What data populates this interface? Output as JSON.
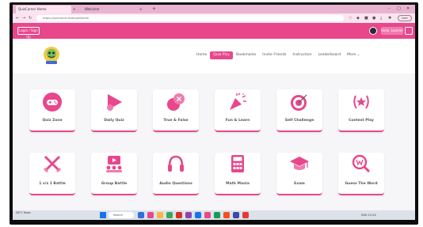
{
  "browser": {
    "tabs": [
      {
        "label": "QuizCorner Home",
        "active": true
      },
      {
        "label": "Welcome",
        "active": false
      }
    ],
    "url": "https://quizcorner.example/home",
    "profile_label": "User"
  },
  "sitebar": {
    "login_label": "Login / Sign Up",
    "user_label": "Hello, Learner"
  },
  "nav": {
    "items": [
      {
        "label": "Home",
        "active": false
      },
      {
        "label": "Quiz Play",
        "active": true
      },
      {
        "label": "Bookmarks",
        "active": false
      },
      {
        "label": "Invite Friends",
        "active": false
      },
      {
        "label": "Instruction",
        "active": false
      },
      {
        "label": "Leaderboard",
        "active": false
      },
      {
        "label": "More ⌄",
        "active": false
      }
    ]
  },
  "cards": [
    {
      "label": "Quiz Zone",
      "icon": "gamepad-icon"
    },
    {
      "label": "Daily Quiz",
      "icon": "play-icon"
    },
    {
      "label": "True & False",
      "icon": "true-false-icon"
    },
    {
      "label": "Fun & Learn",
      "icon": "party-popper-icon"
    },
    {
      "label": "Self Challenge",
      "icon": "target-icon"
    },
    {
      "label": "Contest Play",
      "icon": "star-laurel-icon"
    },
    {
      "label": "1 v/s 1 Battle",
      "icon": "crossed-swords-icon"
    },
    {
      "label": "Group Battle",
      "icon": "group-battle-icon"
    },
    {
      "label": "Audio Questions",
      "icon": "headphones-icon"
    },
    {
      "label": "Math Mania",
      "icon": "calculator-icon"
    },
    {
      "label": "Exam",
      "icon": "graduation-cap-icon"
    },
    {
      "label": "Guess The Word",
      "icon": "guess-word-icon"
    }
  ],
  "taskbar": {
    "weather": "26°C Haze",
    "search": "Search",
    "tray": "ENG  12:24"
  },
  "colors": {
    "brand": "#e8478c",
    "brand_light": "#fbe4f0"
  }
}
